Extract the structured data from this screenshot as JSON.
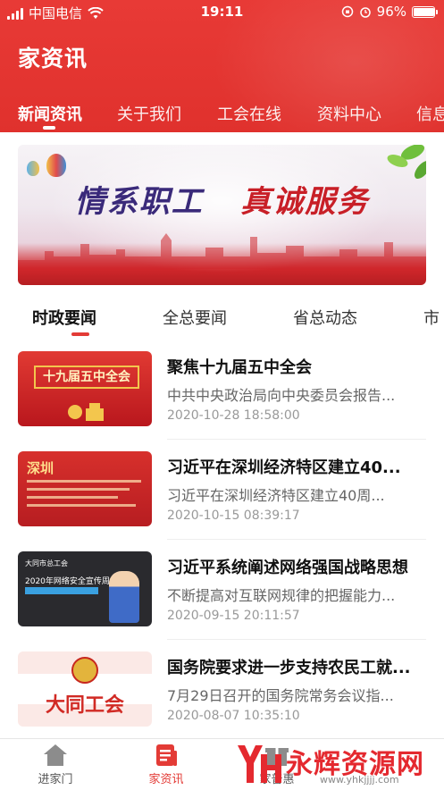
{
  "status_bar": {
    "carrier": "中国电信",
    "time": "19:11",
    "battery": "96%",
    "battery_level": 0.96
  },
  "header": {
    "title": "家资讯",
    "tabs": [
      {
        "label": "新闻资讯",
        "active": true
      },
      {
        "label": "关于我们",
        "active": false
      },
      {
        "label": "工会在线",
        "active": false
      },
      {
        "label": "资料中心",
        "active": false
      },
      {
        "label": "信息",
        "active": false
      }
    ]
  },
  "banner": {
    "slogan_part1": "情系职工",
    "slogan_part2": "真诚服务"
  },
  "subtabs": [
    {
      "label": "时政要闻",
      "active": true
    },
    {
      "label": "全总要闻",
      "active": false
    },
    {
      "label": "省总动态",
      "active": false
    },
    {
      "label": "市",
      "active": false
    }
  ],
  "news": [
    {
      "title": "聚焦十九届五中全会",
      "summary": "中共中央政治局向中央委员会报告...",
      "date": "2020-10-28 18:58:00",
      "thumb_text": "十九届五中全会"
    },
    {
      "title": "习近平在深圳经济特区建立40...",
      "summary": "习近平在深圳经济特区建立40周...",
      "date": "2020-10-15 08:39:17",
      "thumb_text": "深圳"
    },
    {
      "title": "习近平系统阐述网络强国战略思想",
      "summary": "不断提高对互联网规律的把握能力...",
      "date": "2020-09-15 20:11:57",
      "thumb_text": "大同市总工会",
      "thumb_subtext": "2020年网络安全宣传周"
    },
    {
      "title": "国务院要求进一步支持农民工就...",
      "summary": "7月29日召开的国务院常务会议指...",
      "date": "2020-08-07 10:35:10",
      "thumb_text": "大同工会"
    }
  ],
  "bottom_nav": [
    {
      "label": "进家门",
      "icon": "home-icon",
      "active": false
    },
    {
      "label": "家资讯",
      "icon": "news-icon",
      "active": true
    },
    {
      "label": "家普惠",
      "icon": "gift-icon",
      "active": false
    }
  ],
  "watermark": {
    "text": "永辉资源网",
    "url": "www.yhkjjjj.com"
  },
  "colors": {
    "brand_red": "#e33b36",
    "header_red": "#e0312d"
  }
}
